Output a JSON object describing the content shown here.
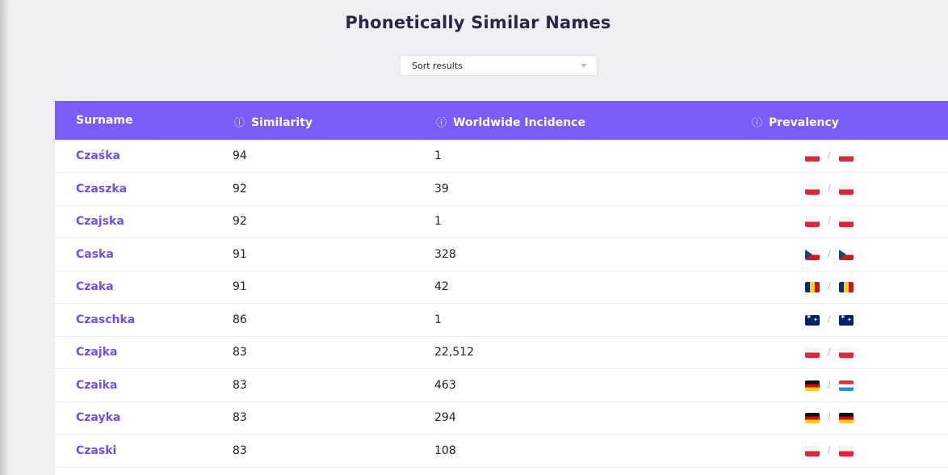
{
  "page": {
    "title": "Phonetically Similar Names"
  },
  "sort": {
    "label": "Sort results"
  },
  "table": {
    "headers": {
      "surname": "Surname",
      "similarity": "Similarity",
      "incidence": "Worldwide Incidence",
      "prevalency": "Prevalency"
    },
    "info_icon": "info-circle-icon",
    "rows": [
      {
        "surname": "Czaśka",
        "similarity": "94",
        "incidence": "1",
        "flag_a": "pl",
        "flag_b": "pl"
      },
      {
        "surname": "Czaszka",
        "similarity": "92",
        "incidence": "39",
        "flag_a": "pl",
        "flag_b": "pl"
      },
      {
        "surname": "Czajska",
        "similarity": "92",
        "incidence": "1",
        "flag_a": "pl",
        "flag_b": "pl"
      },
      {
        "surname": "Caska",
        "similarity": "91",
        "incidence": "328",
        "flag_a": "cz",
        "flag_b": "cz"
      },
      {
        "surname": "Czaka",
        "similarity": "91",
        "incidence": "42",
        "flag_a": "ro",
        "flag_b": "ro"
      },
      {
        "surname": "Czaschka",
        "similarity": "86",
        "incidence": "1",
        "flag_a": "au",
        "flag_b": "au"
      },
      {
        "surname": "Czajka",
        "similarity": "83",
        "incidence": "22,512",
        "flag_a": "pl",
        "flag_b": "pl"
      },
      {
        "surname": "Czaika",
        "similarity": "83",
        "incidence": "463",
        "flag_a": "de",
        "flag_b": "lu"
      },
      {
        "surname": "Czayka",
        "similarity": "83",
        "incidence": "294",
        "flag_a": "de",
        "flag_b": "de"
      },
      {
        "surname": "Czaski",
        "similarity": "83",
        "incidence": "108",
        "flag_a": "pl",
        "flag_b": "pl"
      }
    ],
    "separator": "/"
  },
  "colors": {
    "header_bg": "#7a5cf7",
    "link": "#6f4ff2",
    "panel_bg": "#efeff4",
    "title": "#2a2748"
  }
}
